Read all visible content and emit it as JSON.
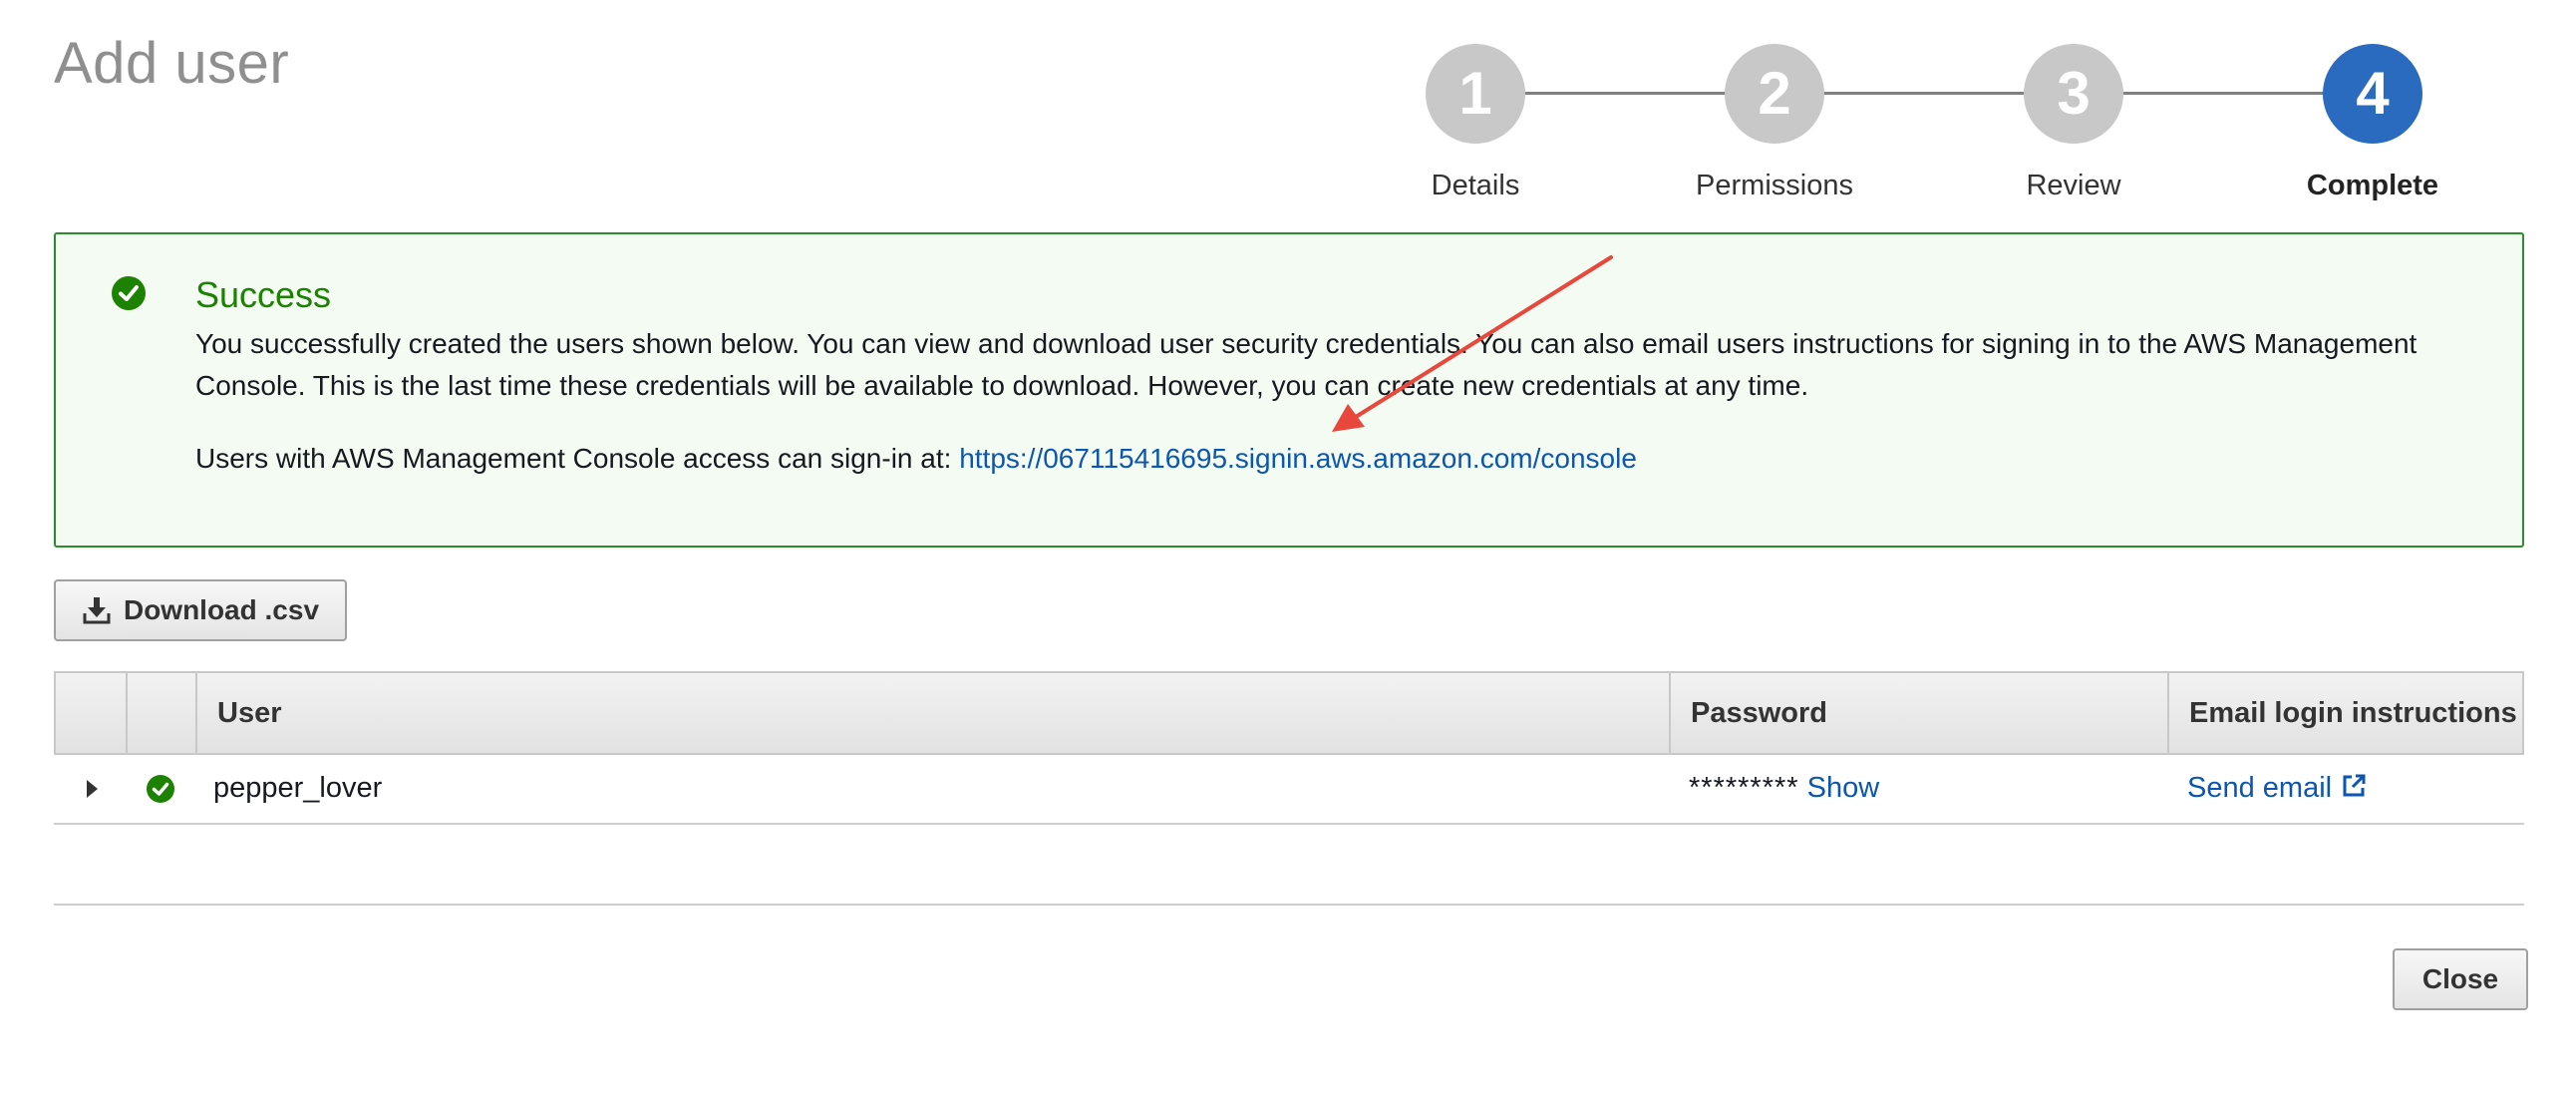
{
  "page": {
    "title": "Add user"
  },
  "stepper": {
    "steps": [
      {
        "number": "1",
        "label": "Details"
      },
      {
        "number": "2",
        "label": "Permissions"
      },
      {
        "number": "3",
        "label": "Review"
      },
      {
        "number": "4",
        "label": "Complete"
      }
    ],
    "active_step": 4,
    "active_color": "#2a6abf",
    "inactive_color": "#c8c8c8"
  },
  "success": {
    "icon": "check-circle-icon",
    "title": "Success",
    "message": "You successfully created the users shown below. You can view and download user security credentials. You can also email users instructions for signing in to the AWS Management Console. This is the last time these credentials will be available to download. However, you can create new credentials at any time.",
    "signin_prefix": "Users with AWS Management Console access can sign-in at: ",
    "signin_url": "https://067115416695.signin.aws.amazon.com/console",
    "accent_color": "#1d8102"
  },
  "toolbar": {
    "download_label": "Download .csv",
    "download_icon": "download-icon"
  },
  "table": {
    "columns": [
      "User",
      "Password",
      "Email login instructions"
    ],
    "rows": [
      {
        "user": "pepper_lover",
        "password_mask": "*********",
        "show_label": "Show",
        "email_label": "Send email",
        "status_icon": "check-circle-icon",
        "expand_icon": "caret-right-icon"
      }
    ]
  },
  "footer": {
    "close_label": "Close"
  },
  "annotation": {
    "type": "arrow",
    "color": "#e8473b",
    "points_to": "signin-url-link"
  }
}
